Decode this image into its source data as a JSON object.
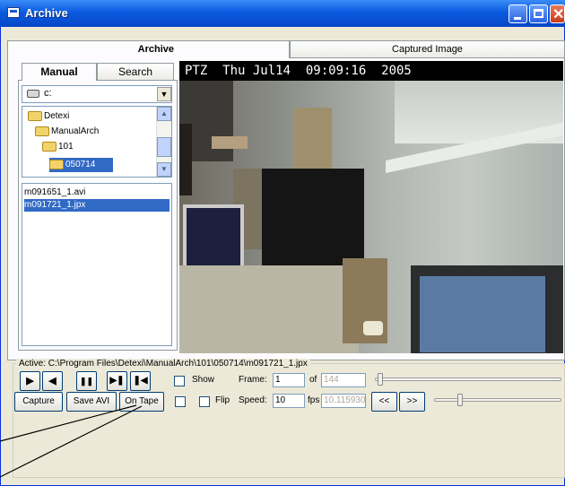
{
  "window": {
    "title": "Archive"
  },
  "tabs": [
    {
      "label": "Archive"
    },
    {
      "label": "Captured Image"
    }
  ],
  "left_panel": {
    "tabs": [
      {
        "label": "Manual"
      },
      {
        "label": "Search"
      }
    ],
    "drive": "c:",
    "tree": [
      {
        "label": "Detexi"
      },
      {
        "label": "ManualArch"
      },
      {
        "label": "101"
      },
      {
        "label": "050714"
      }
    ],
    "files": [
      {
        "label": "m091651_1.avi"
      },
      {
        "label": "m091721_1.jpx"
      }
    ]
  },
  "video": {
    "overlay": "PTZ  Thu Jul14  09:09:16  2005"
  },
  "controls": {
    "active": "Active: C:\\Program Files\\Detexi\\ManualArch\\101\\050714\\m091721_1.jpx",
    "playback": {
      "play": "▶",
      "back": "◀",
      "pause": "❚❚",
      "step_forward": "▶❚",
      "step_back": "❚◀"
    },
    "show_label": "Show",
    "frame_label": "Frame:",
    "frame_value": "1",
    "of_label": "of",
    "frame_total": "144",
    "capture_label": "Capture",
    "save_avi_label": "Save AVI",
    "on_tape_label": "On Tape",
    "flip_label": "Flip",
    "speed_label": "Speed:",
    "speed_value": "10",
    "fps_label": "fps",
    "fps_value": "10.115930",
    "rewind_label": "<<",
    "forward_label": ">>"
  }
}
